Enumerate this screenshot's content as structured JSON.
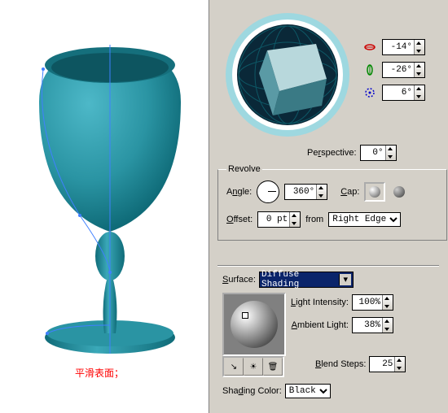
{
  "caption": "平滑表面；",
  "rotation": {
    "x_label": "-14°",
    "y_label": "-26°",
    "z_label": "6°"
  },
  "perspective": {
    "label": "Perspective:",
    "value": "0°"
  },
  "revolve": {
    "legend": "Revolve",
    "angle_label": "Angle:",
    "angle_value": "360°",
    "cap_label": "Cap:",
    "offset_label": "Offset:",
    "offset_value": "0 pt",
    "from_label": "from",
    "from_value": "Right Edge"
  },
  "surface": {
    "label": "Surface:",
    "value": "Diffuse Shading",
    "light_label": "Light Intensity:",
    "light_value": "100%",
    "ambient_label": "Ambient Light:",
    "ambient_value": "38%",
    "blend_label": "Blend Steps:",
    "blend_value": "25",
    "shade_label": "Shading Color:",
    "shade_value": "Black"
  },
  "icons": {
    "x": "rotate-x-icon",
    "y": "rotate-y-icon",
    "z": "rotate-z-icon",
    "new": "new-light-icon",
    "trash": "trash-icon",
    "back": "send-back-icon",
    "arrow": "light-arrow-icon"
  },
  "colors": {
    "goblet": "#2a94a3",
    "goblet_dark": "#0f6b78",
    "panel": "#d4d0c8",
    "sel": "#0a246a"
  }
}
